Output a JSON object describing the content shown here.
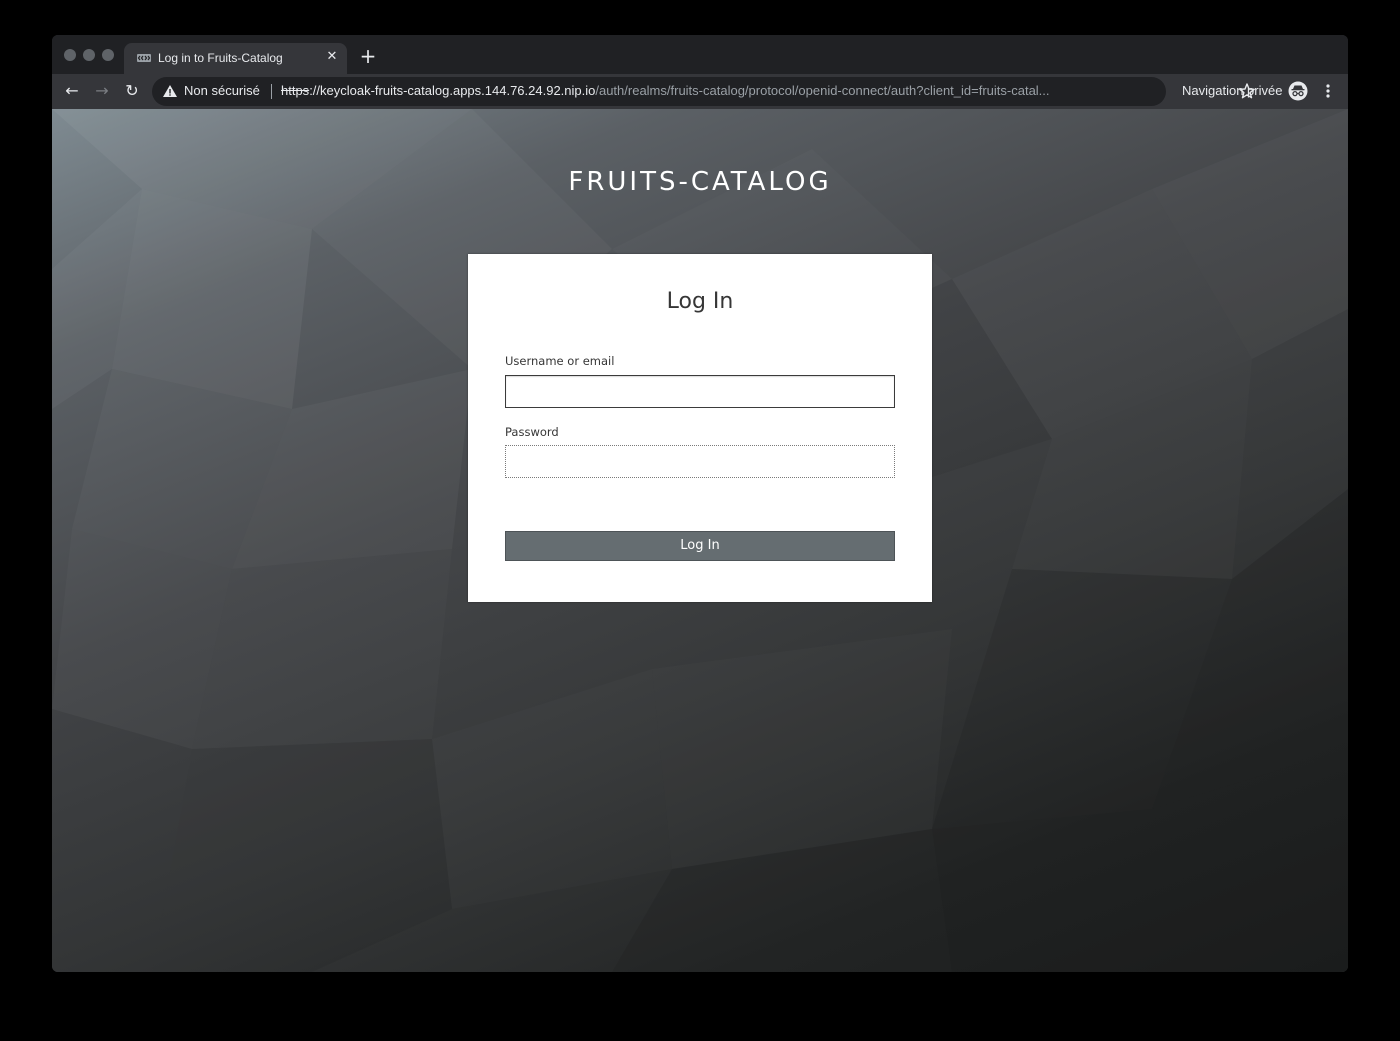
{
  "browser": {
    "tab": {
      "title": "Log in to Fruits-Catalog",
      "favicon_icon": "keycloak-favicon-icon",
      "close_glyph": "✕"
    },
    "new_tab_glyph": "+",
    "toolbar": {
      "back_glyph": "←",
      "forward_glyph": "→",
      "reload_glyph": "↻"
    },
    "omnibox": {
      "security_label": "Non sécurisé",
      "url_scheme": "https",
      "url_host_part": "://keycloak-fruits-catalog.apps.144.76.24.92.nip.io",
      "url_path_part": "/auth/realms/fruits-catalog/protocol/openid-connect/auth?client_id=fruits-catal..."
    },
    "incognito_label": "Navigation privée"
  },
  "page": {
    "realm_title": "FRUITS-CATALOG",
    "login_form": {
      "title": "Log In",
      "username_label": "Username or email",
      "username_value": "",
      "password_label": "Password",
      "password_value": "",
      "submit_label": "Log In"
    }
  },
  "colors": {
    "button_bg": "#656d71",
    "card_bg": "#ffffff",
    "browser_chrome": "#35363a",
    "tabstrip": "#202124"
  }
}
